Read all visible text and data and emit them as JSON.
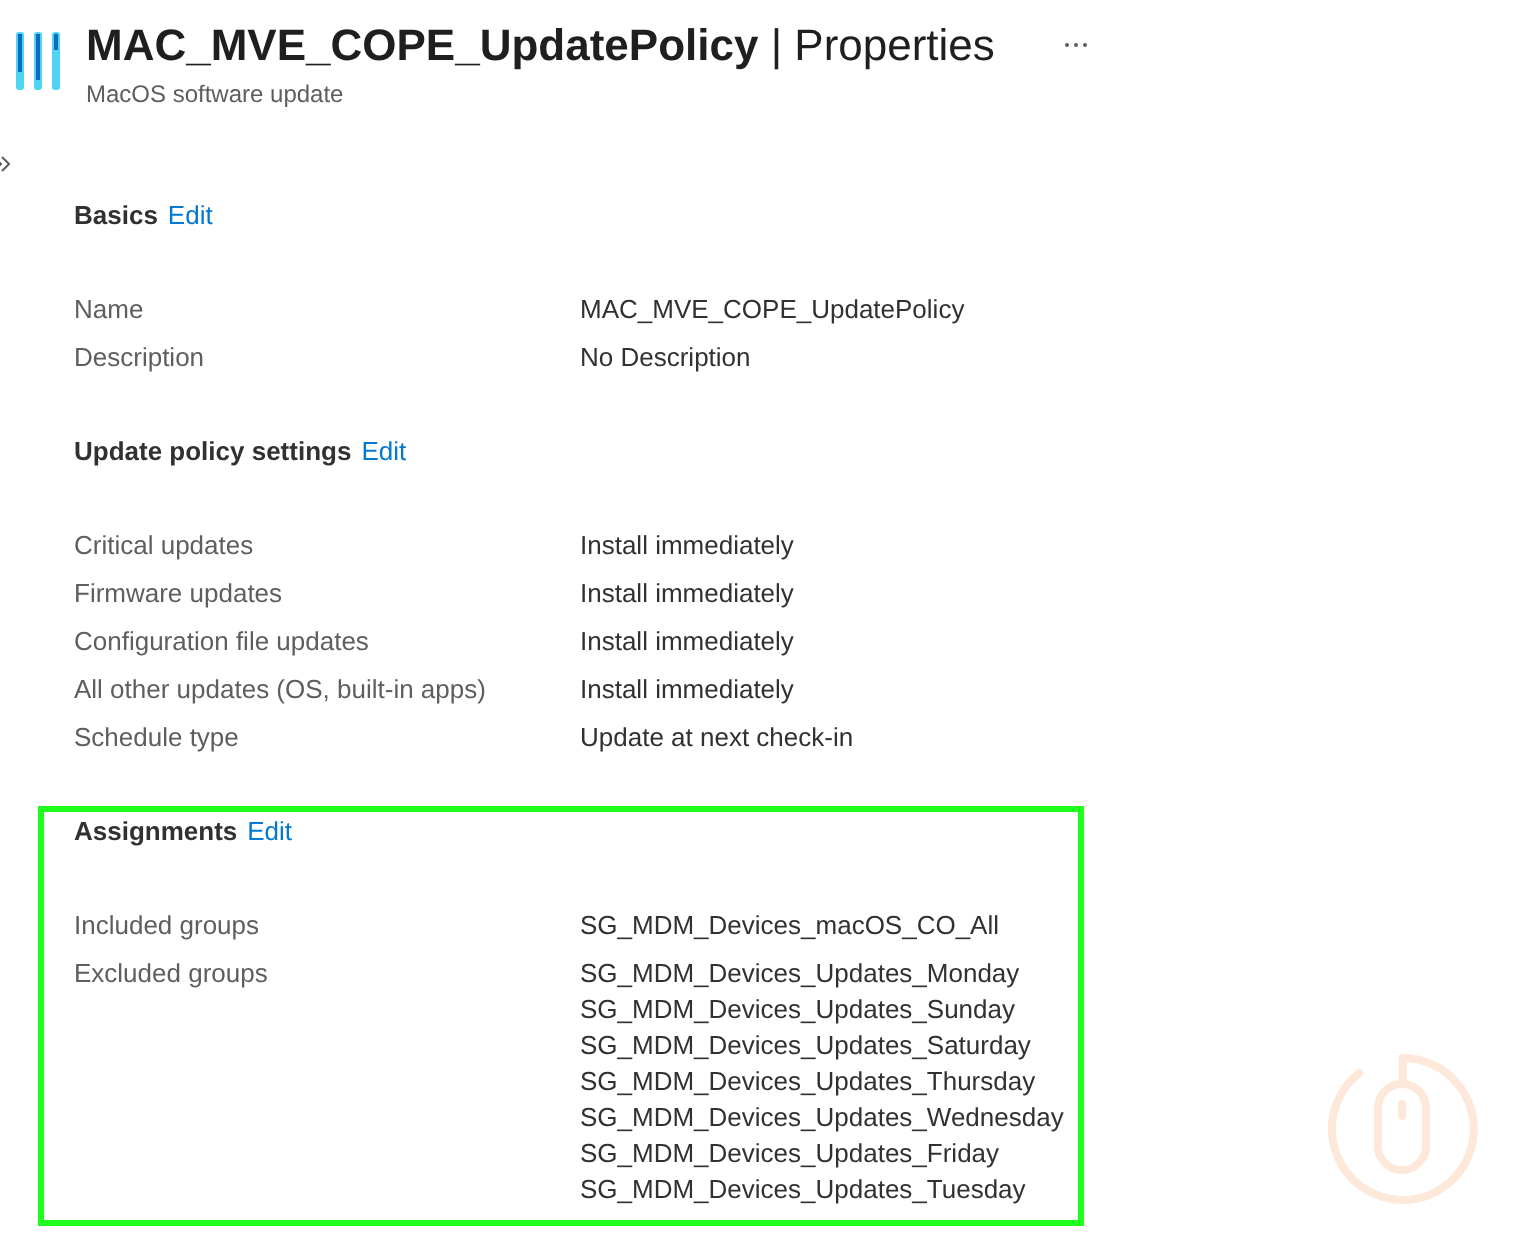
{
  "header": {
    "title": "**MAC_MVE_COPE_UpdatePolicy** | Properties",
    "subtitle": "MacOS software update"
  },
  "sections": [
    {
      "title": "Basics",
      "edit_link": "Edit",
      "highlighted": false,
      "rows": [
        {
          "label": "Name",
          "values": [
            "MAC_MVE_COPE_UpdatePolicy"
          ]
        },
        {
          "label": "Description",
          "values": [
            "No Description"
          ]
        }
      ]
    },
    {
      "title": "Update policy settings",
      "edit_link": "Edit",
      "highlighted": false,
      "rows": [
        {
          "label": "Critical updates",
          "values": [
            "Install immediately"
          ]
        },
        {
          "label": "Firmware updates",
          "values": [
            "Install immediately"
          ]
        },
        {
          "label": "Configuration file updates",
          "values": [
            "Install immediately"
          ]
        },
        {
          "label": "All other updates (OS, built-in apps)",
          "values": [
            "Install immediately"
          ]
        },
        {
          "label": "Schedule type",
          "values": [
            "Update at next check-in"
          ]
        }
      ]
    },
    {
      "title": "Assignments",
      "edit_link": "Edit",
      "highlighted": true,
      "rows": [
        {
          "label": "Included groups",
          "values": [
            "SG_MDM_Devices_macOS_CO_All"
          ]
        },
        {
          "label": "Excluded groups",
          "values": [
            "SG_MDM_Devices_Updates_Monday",
            "SG_MDM_Devices_Updates_Sunday",
            "SG_MDM_Devices_Updates_Saturday",
            "SG_MDM_Devices_Updates_Thursday",
            "SG_MDM_Devices_Updates_Wednesday",
            "SG_MDM_Devices_Updates_Friday",
            "SG_MDM_Devices_Updates_Tuesday"
          ]
        }
      ]
    }
  ]
}
